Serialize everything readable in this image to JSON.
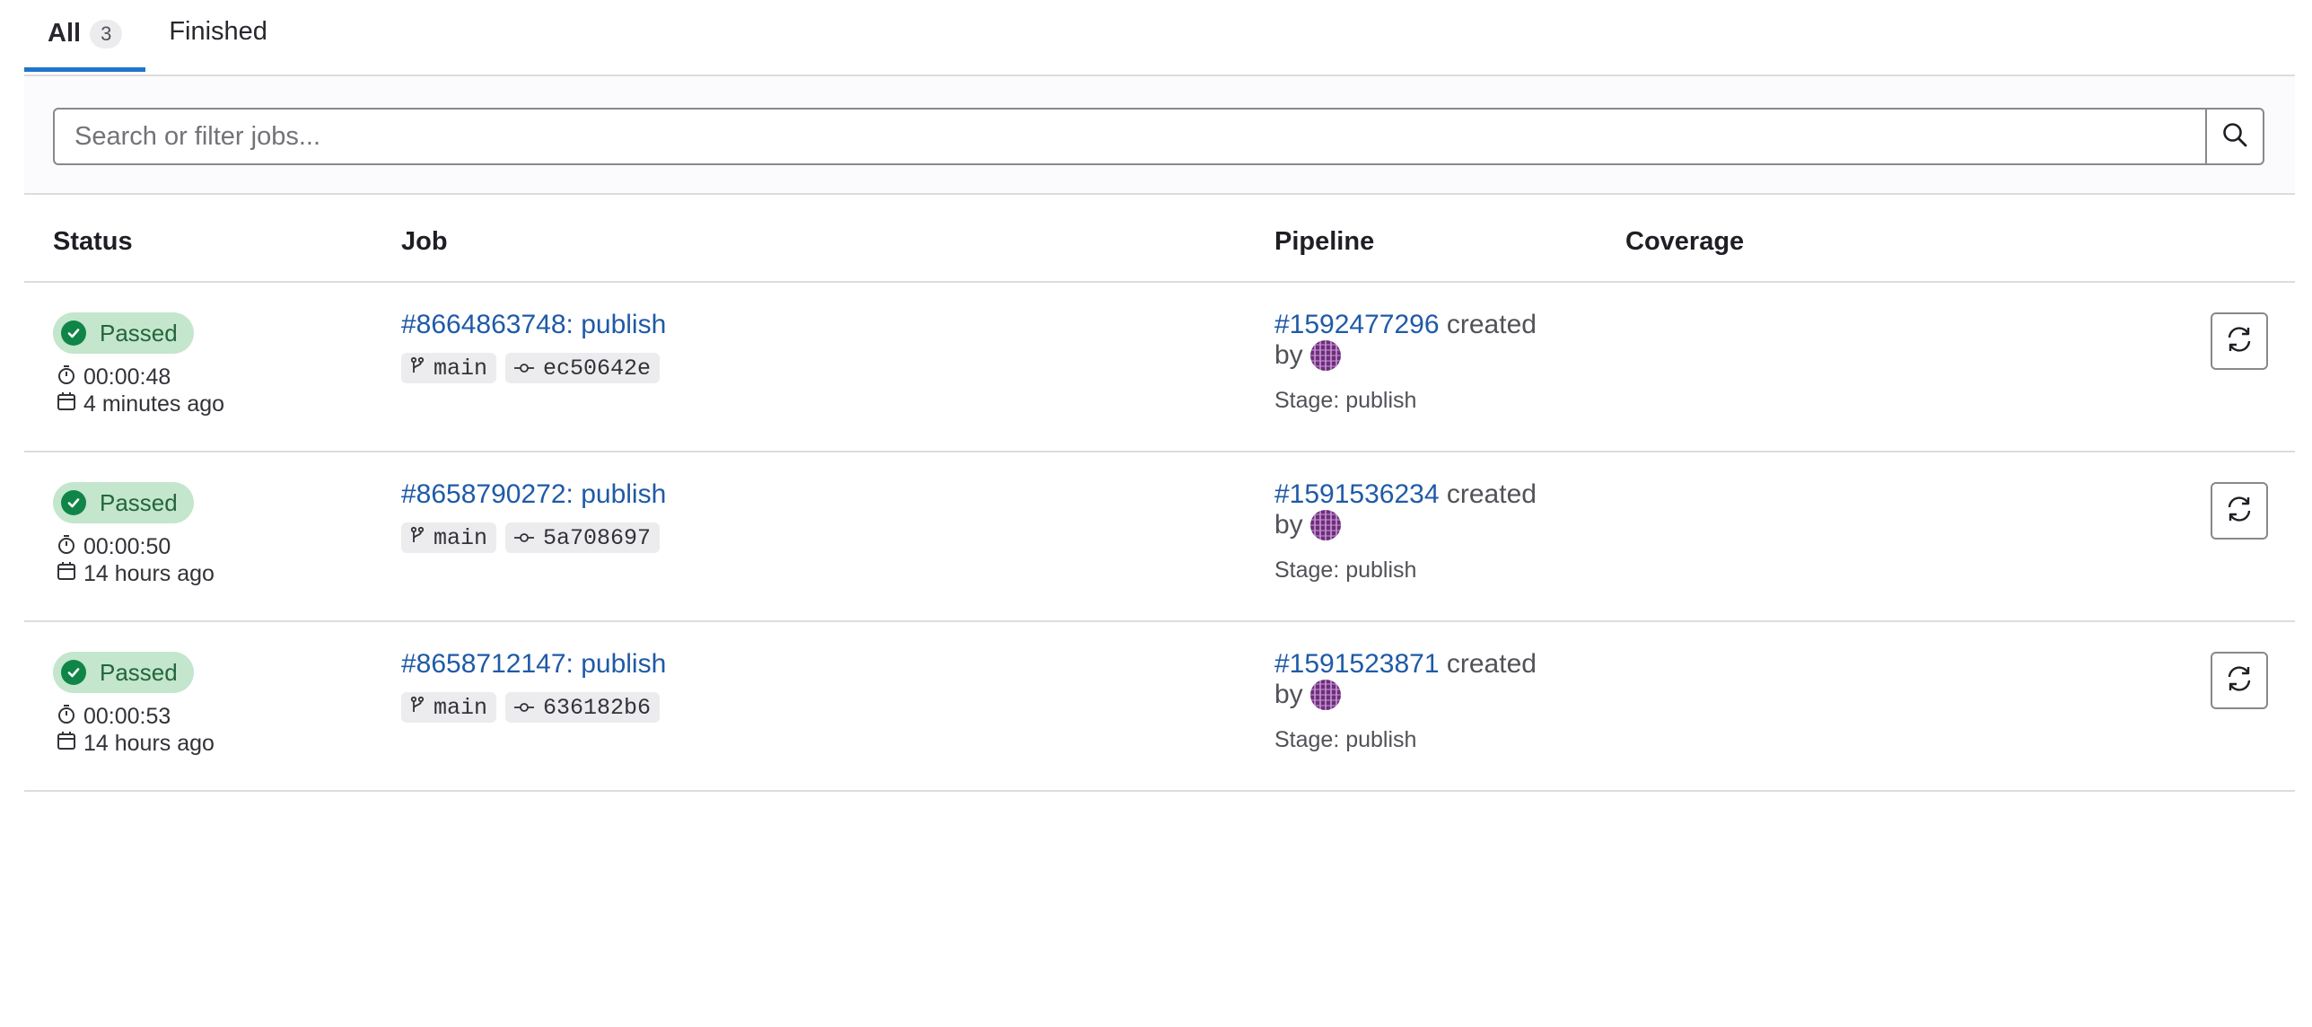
{
  "tabs": [
    {
      "label": "All",
      "count": "3",
      "active": true
    },
    {
      "label": "Finished"
    }
  ],
  "search": {
    "placeholder": "Search or filter jobs...",
    "icon": "search-icon"
  },
  "table": {
    "headers": {
      "status": "Status",
      "job": "Job",
      "pipeline": "Pipeline",
      "coverage": "Coverage"
    },
    "rows": [
      {
        "status": "Passed",
        "duration": "00:00:48",
        "finished": "4 minutes ago",
        "job": "#8664863748: publish",
        "branch": "main",
        "commit": "ec50642e",
        "pipeline": "#1592477296",
        "created": "created",
        "by": "by",
        "stage": "Stage: publish"
      },
      {
        "status": "Passed",
        "duration": "00:00:50",
        "finished": "14 hours ago",
        "job": "#8658790272: publish",
        "branch": "main",
        "commit": "5a708697",
        "pipeline": "#1591536234",
        "created": "created",
        "by": "by",
        "stage": "Stage: publish"
      },
      {
        "status": "Passed",
        "duration": "00:00:53",
        "finished": "14 hours ago",
        "job": "#8658712147: publish",
        "branch": "main",
        "commit": "636182b6",
        "pipeline": "#1591523871",
        "created": "created",
        "by": "by",
        "stage": "Stage: publish"
      }
    ]
  },
  "colors": {
    "accent": "#1f75cb",
    "link": "#1f5aa6",
    "success_bg": "#c3e6cd",
    "success_fg": "#24663b",
    "success_icon": "#108548"
  }
}
